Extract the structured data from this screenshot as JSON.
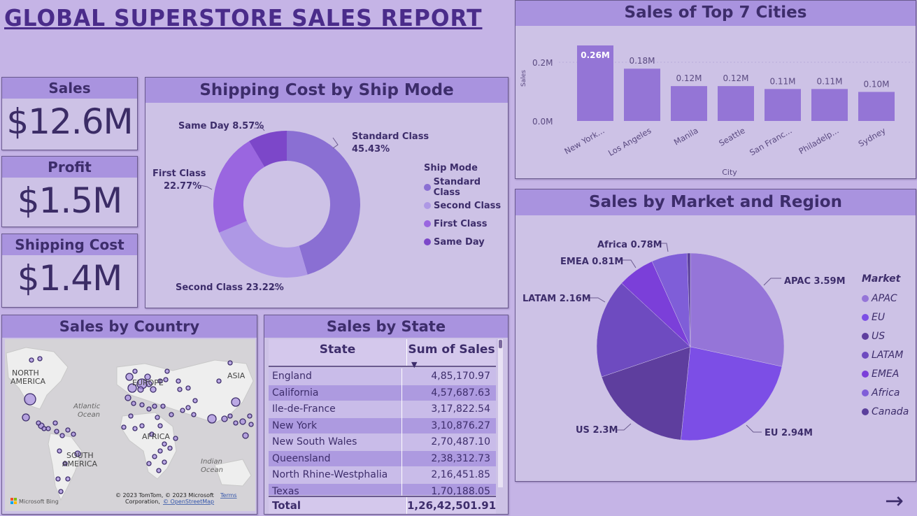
{
  "title": "GLOBAL SUPERSTORE SALES REPORT",
  "kpis": {
    "sales": {
      "label": "Sales",
      "value": "$12.6M"
    },
    "profit": {
      "label": "Profit",
      "value": "$1.5M"
    },
    "shipping": {
      "label": "Shipping Cost",
      "value": "$1.4M"
    }
  },
  "ship_mode": {
    "title": "Shipping Cost by Ship Mode",
    "legend_title": "Ship Mode",
    "labels": {
      "standard_name": "Standard Class",
      "standard_pct": "45.43%",
      "second": "Second Class 23.22%",
      "first_name": "First Class",
      "first_pct": "22.77%",
      "same": "Same Day 8.57%"
    },
    "legend": [
      "Standard Class",
      "Second Class",
      "First Class",
      "Same Day"
    ]
  },
  "cities": {
    "title": "Sales of Top 7 Cities",
    "ylabel": "Sales",
    "xlabel": "City",
    "yticks": [
      "0.2M",
      "0.0M"
    ]
  },
  "market": {
    "title": "Sales by Market and Region",
    "legend_title": "Market",
    "legend": [
      "APAC",
      "EU",
      "US",
      "LATAM",
      "EMEA",
      "Africa",
      "Canada"
    ],
    "labels": {
      "apac": "APAC 3.59M",
      "eu": "EU 2.94M",
      "us": "US 2.3M",
      "latam": "LATAM 2.16M",
      "emea": "EMEA 0.81M",
      "africa": "Africa 0.78M"
    }
  },
  "country": {
    "title": "Sales by Country",
    "labels": {
      "na1": "NORTH",
      "na2": "AMERICA",
      "europe": "EUROPE",
      "asia": "ASIA",
      "atlantic1": "Atlantic",
      "atlantic2": "Ocean",
      "africa": "AFRICA",
      "sa1": "SOUTH",
      "sa2": "AMERICA",
      "indian1": "Indian",
      "indian2": "Ocean"
    },
    "bing": "Microsoft Bing",
    "copyright1": "© 2023 TomTom, © 2023 Microsoft",
    "terms": "Terms",
    "copyright2": "Corporation,",
    "osm": "© OpenStreetMap"
  },
  "state": {
    "title": "Sales by State",
    "col_state": "State",
    "col_sales": "Sum of Sales",
    "rows": [
      {
        "state": "England",
        "sales": "4,85,170.97"
      },
      {
        "state": "California",
        "sales": "4,57,687.63"
      },
      {
        "state": "Ile-de-France",
        "sales": "3,17,822.54"
      },
      {
        "state": "New York",
        "sales": "3,10,876.27"
      },
      {
        "state": "New South Wales",
        "sales": "2,70,487.10"
      },
      {
        "state": "Queensland",
        "sales": "2,38,312.73"
      },
      {
        "state": "North Rhine-Westphalia",
        "sales": "2,16,451.85"
      },
      {
        "state": "Texas",
        "sales": "1,70,188.05"
      }
    ],
    "total_label": "Total",
    "total_value": "1,26,42,501.91"
  },
  "chart_data": [
    {
      "type": "bar",
      "title": "Sales of Top 7 Cities",
      "xlabel": "City",
      "ylabel": "Sales",
      "categories": [
        "New York...",
        "Los Angeles",
        "Manila",
        "Seattle",
        "San Franc...",
        "Philadelp...",
        "Sydney"
      ],
      "values": [
        0.26,
        0.18,
        0.12,
        0.12,
        0.11,
        0.11,
        0.1
      ],
      "value_labels": [
        "0.26M",
        "0.18M",
        "0.12M",
        "0.12M",
        "0.11M",
        "0.11M",
        "0.10M"
      ],
      "unit": "M",
      "ylim": [
        0,
        0.26
      ],
      "color": "#9475d6"
    },
    {
      "type": "pie",
      "title": "Shipping Cost by Ship Mode",
      "donut": true,
      "categories": [
        "Standard Class",
        "Second Class",
        "First Class",
        "Same Day"
      ],
      "values": [
        45.43,
        23.22,
        22.77,
        8.57
      ],
      "colors": [
        "#8a6fd3",
        "#ae98e5",
        "#9a66e0",
        "#7c47c9"
      ]
    },
    {
      "type": "pie",
      "title": "Sales by Market and Region",
      "categories": [
        "APAC",
        "EU",
        "US",
        "LATAM",
        "EMEA",
        "Africa",
        "Canada"
      ],
      "values": [
        3.59,
        2.94,
        2.3,
        2.16,
        0.81,
        0.78,
        0.07
      ],
      "colors": [
        "#9575d8",
        "#7c4ee6",
        "#5e3e9e",
        "#6e4bc0",
        "#7b3fd9",
        "#7f5ed8",
        "#5a3f9c"
      ]
    }
  ]
}
